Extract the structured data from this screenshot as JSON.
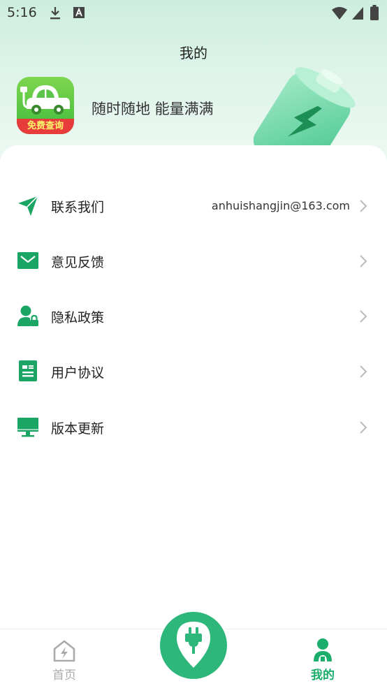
{
  "status": {
    "time": "5:16"
  },
  "header": {
    "title": "我的",
    "slogan": "随时随地 能量满满"
  },
  "app_logo": {
    "badge": "免费查询"
  },
  "menu": [
    {
      "label": "联系我们",
      "value": "anhuishangjin@163.com",
      "icon": "send-icon"
    },
    {
      "label": "意见反馈",
      "icon": "mail-icon"
    },
    {
      "label": "隐私政策",
      "icon": "user-lock-icon"
    },
    {
      "label": "用户协议",
      "icon": "document-icon"
    },
    {
      "label": "版本更新",
      "icon": "monitor-icon"
    }
  ],
  "tabbar": {
    "home": "首页",
    "mine": "我的",
    "active_color": "#1aad6b",
    "inactive_color": "#aaaaaa"
  },
  "colors": {
    "accent": "#1aad6b",
    "icon_green": "#1aa564"
  }
}
